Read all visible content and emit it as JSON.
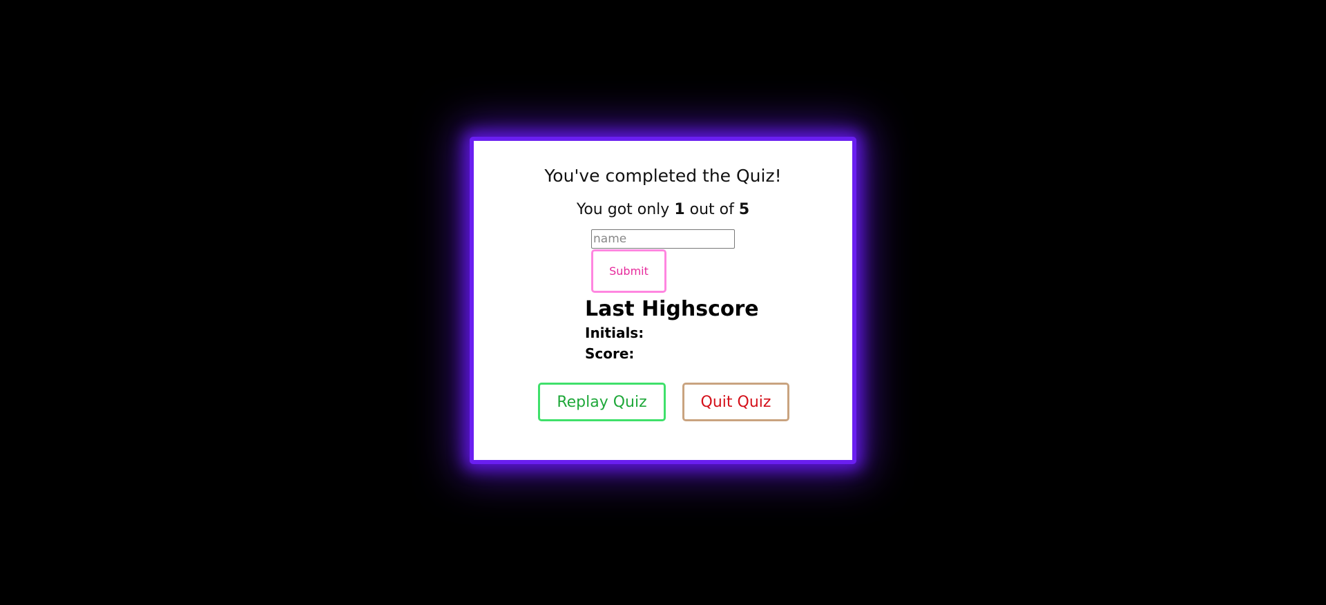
{
  "result": {
    "title": "You've completed the Quiz!",
    "score_prefix": "You got only",
    "score_value": "1",
    "score_middle": "out of",
    "score_total": "5"
  },
  "form": {
    "name_placeholder": "name",
    "name_value": "",
    "submit_label": "Submit"
  },
  "highscore": {
    "title": "Last Highscore",
    "initials_label": "Initials:",
    "initials_value": "",
    "score_label": "Score:",
    "score_value": ""
  },
  "actions": {
    "replay_label": "Replay Quiz",
    "quit_label": "Quit Quiz"
  },
  "colors": {
    "background": "#000000",
    "box_glow": "#6a1ff0",
    "submit_border": "#ff86e0",
    "submit_text": "#e6299b",
    "replay_border": "#3fe06a",
    "replay_text": "#1fa83a",
    "quit_border": "#c9a37f",
    "quit_text": "#d4101a"
  }
}
